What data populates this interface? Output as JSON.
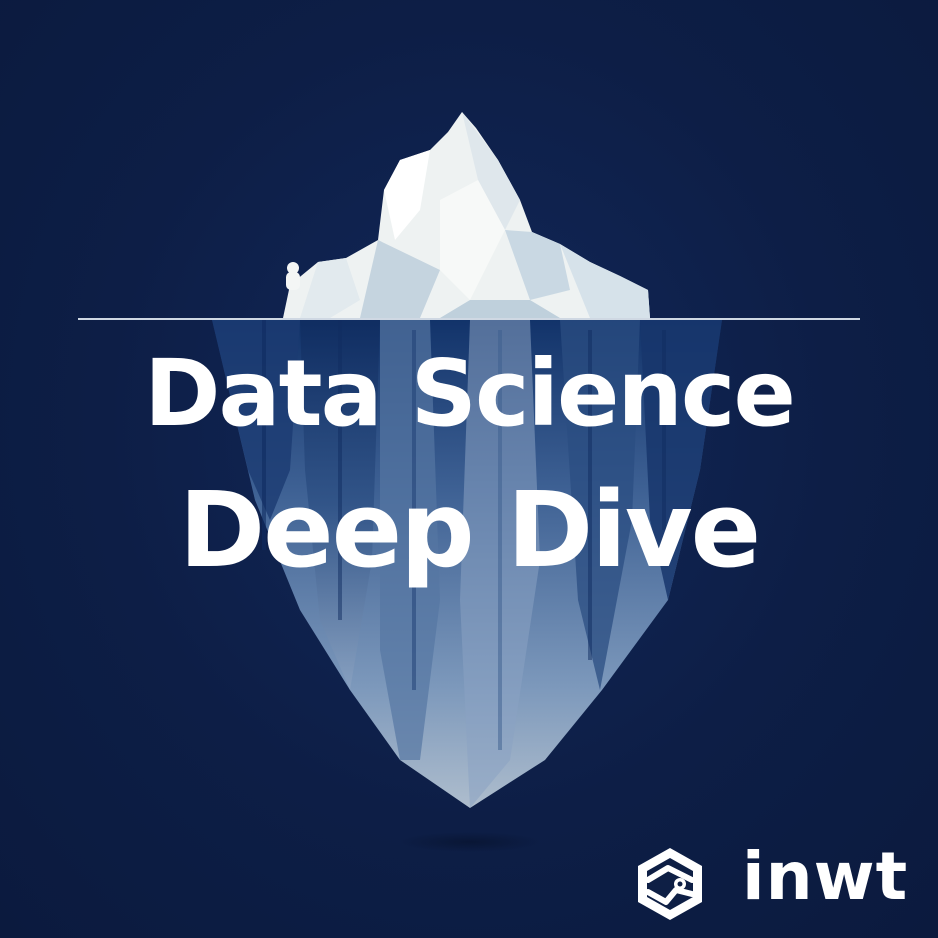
{
  "title": {
    "line1": "Data Science",
    "line2": "Deep Dive"
  },
  "brand": {
    "name": "inwt",
    "icon": "inwt-hexagon-logo-icon"
  },
  "scene": {
    "illustration": "iceberg-icon",
    "colors": {
      "background": "#0e1f45",
      "ice_top": "#f2f4f3",
      "ice_shadow": "#cfdde6",
      "ice_underwater": "#6f8fb4",
      "waterline": "#cfd8e3",
      "text": "#ffffff"
    }
  }
}
